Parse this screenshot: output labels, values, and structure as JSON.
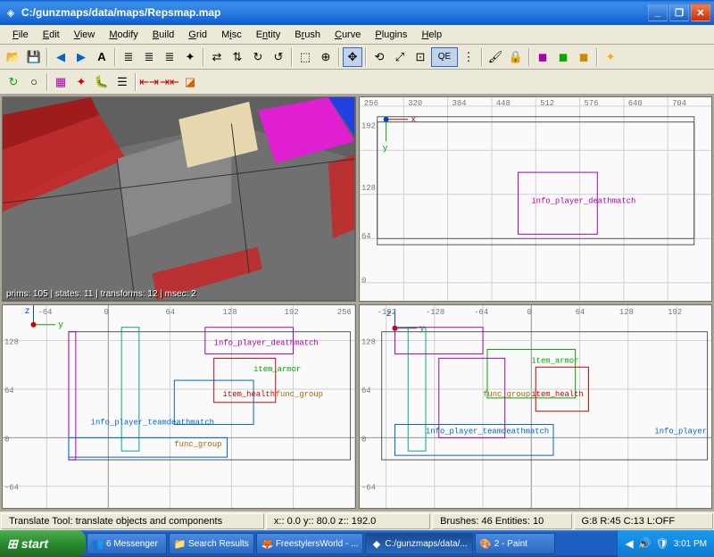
{
  "window": {
    "title": "C:/gunzmaps/data/maps/Repsmap.map"
  },
  "menu": {
    "file": "File",
    "edit": "Edit",
    "view": "View",
    "modify": "Modify",
    "build": "Build",
    "grid": "Grid",
    "misc": "Misc",
    "entity": "Entity",
    "brush": "Brush",
    "curve": "Curve",
    "plugins": "Plugins",
    "help": "Help"
  },
  "viewport3d": {
    "status": "prims: 105 | states: 11 | transforms: 12 | msec: 2"
  },
  "top_right": {
    "axis_h": "x",
    "axis_v": "y",
    "ticks_x": [
      "256",
      "320",
      "384",
      "448",
      "512",
      "576",
      "640",
      "704"
    ],
    "ticks_y": [
      "192",
      "128",
      "64",
      "0"
    ],
    "entities": {
      "info_player": "info_player_deathmatch"
    }
  },
  "bottom_left": {
    "axis_h": "y",
    "axis_v": "z",
    "ticks_x": [
      "-64",
      "0",
      "64",
      "128",
      "192",
      "256"
    ],
    "ticks_y": [
      "128",
      "64",
      "0",
      "-64"
    ],
    "entities": {
      "info_player_dm": "info_player_deathmatch",
      "item_armor": "item_armor",
      "item_health": "item_health",
      "func_group": "func_group",
      "func_group2": "func_group",
      "info_player_team": "info_player_teamdeathmatch"
    }
  },
  "bottom_right": {
    "axis_h": "y",
    "axis_v": "z",
    "ticks_x": [
      "-192",
      "-128",
      "-64",
      "0",
      "64",
      "128",
      "192"
    ],
    "ticks_y": [
      "128",
      "64",
      "0",
      "-64"
    ],
    "entities": {
      "item_armor": "item_armor",
      "item_health": "item_health",
      "func_group": "func_group",
      "info_player_team": "info_player_teamdeathmatch",
      "info_player2": "info_player"
    }
  },
  "statusbar": {
    "tool": "Translate Tool: translate objects and components",
    "coords": "x::   0.0  y::   80.0  z::  192.0",
    "brushes": "Brushes: 46 Entities: 10",
    "grid": "G:8  R:45  C:13  L:OFF"
  },
  "taskbar": {
    "start": "start",
    "tasks": [
      {
        "label": "6 Messenger",
        "icon": "👥"
      },
      {
        "label": "Search Results",
        "icon": "📁"
      },
      {
        "label": "FreestylersWorld - ...",
        "icon": "🦊"
      },
      {
        "label": "C:/gunzmaps/data/...",
        "icon": "◆",
        "active": true
      },
      {
        "label": "2 - Paint",
        "icon": "🎨"
      }
    ],
    "clock": "3:01 PM"
  }
}
